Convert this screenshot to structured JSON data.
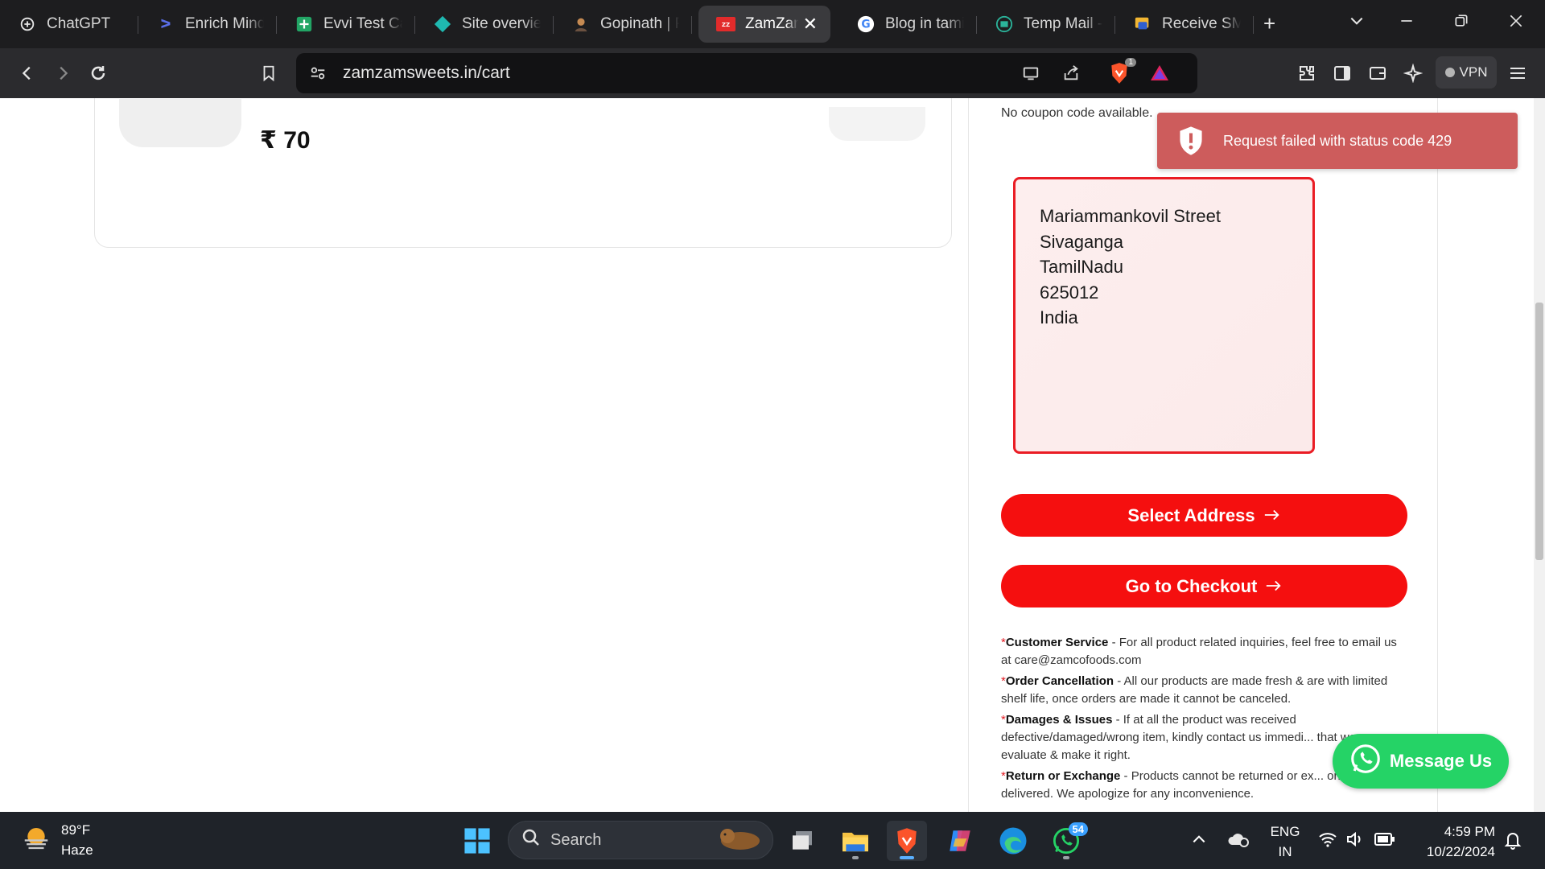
{
  "browser": {
    "tabs": [
      {
        "label": "ChatGPT",
        "icon": "chatgpt-icon",
        "color": "#ffffff"
      },
      {
        "label": "Enrich Minds",
        "icon": "enrich-minds-icon",
        "color": "#5a6ee8"
      },
      {
        "label": "Evvi Test Cases",
        "icon": "sheets-icon",
        "color": "#22a565"
      },
      {
        "label": "Site overview",
        "icon": "site-diamond-icon",
        "color": "#1fb8b0"
      },
      {
        "label": "Gopinath | P",
        "icon": "avatar-icon",
        "color": "#c58a52"
      },
      {
        "label": "ZamZam",
        "icon": "zamzam-icon",
        "color": "#e22b2b",
        "active": true
      },
      {
        "label": "Blog in tamil",
        "icon": "google-icon",
        "color": "#4285f4"
      },
      {
        "label": "Temp Mail -",
        "icon": "tempmail-icon",
        "color": "#2bb39a"
      },
      {
        "label": "Receive SMS",
        "icon": "sms-icon",
        "color": "#f2b632"
      }
    ],
    "url": "zamzamsweets.in/cart",
    "shields_count": "1",
    "vpn_label": "VPN"
  },
  "cart": {
    "price": "₹ 70"
  },
  "checkout": {
    "coupon_text": "No coupon code available.",
    "address_lines": [
      "Mariammankovil Street",
      "Sivaganga",
      "TamilNadu",
      "625012",
      "India"
    ],
    "select_address_label": "Select Address",
    "checkout_label": "Go to Checkout",
    "policies": [
      {
        "title": "Customer Service",
        "text": " - For all product related inquiries, feel free to email us at care@zamcofoods.com"
      },
      {
        "title": "Order Cancellation",
        "text": " - All our products are made fresh & are with limited shelf life, once orders are made it cannot be canceled."
      },
      {
        "title": "Damages & Issues",
        "text": " - If at all the product was received defective/damaged/wrong item, kindly contact us immedi... that we can evaluate & make it right."
      },
      {
        "title": "Return or Exchange",
        "text": " - Products cannot be returned or ex... once delivered. We apologize for any inconvenience."
      }
    ]
  },
  "toast": {
    "message": "Request failed with status code 429",
    "color": "#cd5c5c"
  },
  "whatsapp": {
    "label": "Message Us",
    "color": "#25d366"
  },
  "taskbar": {
    "weather_temp": "89°F",
    "weather_desc": "Haze",
    "search_placeholder": "Search",
    "whatsapp_badge": "54",
    "lang_top": "ENG",
    "lang_bottom": "IN",
    "time": "4:59 PM",
    "date": "10/22/2024"
  },
  "colors": {
    "accent_red": "#f50f0f",
    "address_border": "#ea1c24"
  }
}
